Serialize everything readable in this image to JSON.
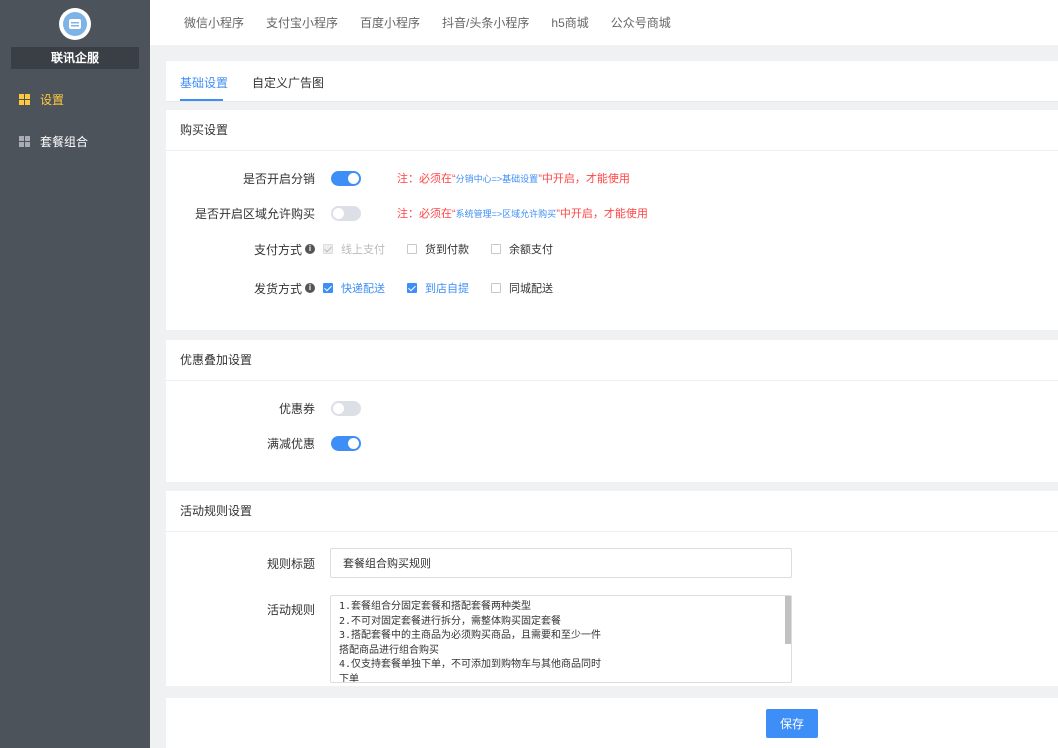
{
  "sidebar": {
    "brand_name": "联讯企服",
    "items": [
      {
        "label": "设置",
        "active": true
      },
      {
        "label": "套餐组合",
        "active": false
      }
    ]
  },
  "top_tabs": [
    "微信小程序",
    "支付宝小程序",
    "百度小程序",
    "抖音/头条小程序",
    "h5商城",
    "公众号商城"
  ],
  "sub_tabs": {
    "basic": "基础设置",
    "ad": "自定义广告图"
  },
  "buy_settings": {
    "title": "购买设置",
    "distribution": {
      "label": "是否开启分销",
      "on": true,
      "note_prefix": "注：必须在“",
      "note_link": "分销中心=>基础设置",
      "note_suffix": "”中开启，才能使用"
    },
    "region": {
      "label": "是否开启区域允许购买",
      "on": false,
      "note_prefix": "注：必须在“",
      "note_link": "系统管理=>区域允许购买",
      "note_suffix": "”中开启，才能使用"
    },
    "payment": {
      "label": "支付方式",
      "options": [
        {
          "label": "线上支付",
          "checked": true,
          "disabled": true
        },
        {
          "label": "货到付款",
          "checked": false,
          "disabled": false
        },
        {
          "label": "余额支付",
          "checked": false,
          "disabled": false
        }
      ]
    },
    "delivery": {
      "label": "发货方式",
      "options": [
        {
          "label": "快递配送",
          "checked": true
        },
        {
          "label": "到店自提",
          "checked": true
        },
        {
          "label": "同城配送",
          "checked": false
        }
      ]
    }
  },
  "promo_settings": {
    "title": "优惠叠加设置",
    "coupon": {
      "label": "优惠券",
      "on": false
    },
    "discount": {
      "label": "满减优惠",
      "on": true
    }
  },
  "rule_settings": {
    "title": "活动规则设置",
    "title_label": "规则标题",
    "title_value": "套餐组合购买规则",
    "rules_label": "活动规则",
    "rules_text": "1.套餐组合分固定套餐和搭配套餐两种类型\n2.不可对固定套餐进行拆分，需整体购买固定套餐\n3.搭配套餐中的主商品为必须购买商品，且需要和至少一件\n搭配商品进行组合购买\n4.仅支持套餐单独下单，不可添加到购物车与其他商品同时\n下单"
  },
  "footer": {
    "save_label": "保存"
  },
  "colors": {
    "accent": "#3e8ef7",
    "sidebar_bg": "#4d535b",
    "active_nav": "#ffc93d",
    "warning": "#ff4444"
  }
}
